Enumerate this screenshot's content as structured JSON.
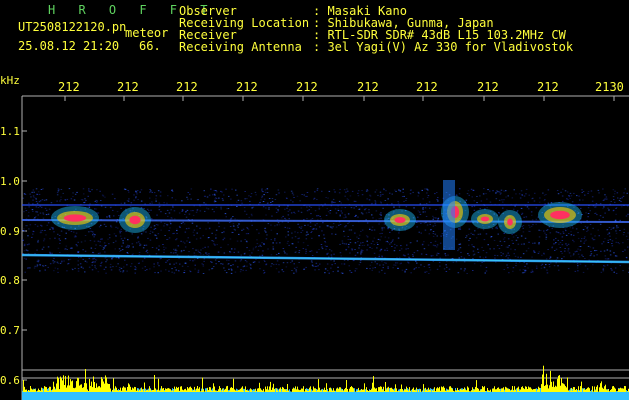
{
  "header": {
    "title": "H R O F F T",
    "file_name": "UT2508122120.pn",
    "mode": "meteor",
    "datetime": "25.08.12 21:20",
    "count": "66.",
    "fields": [
      {
        "label": "Observer",
        "value": ": Masaki Kano"
      },
      {
        "label": "Receiving Location",
        "value": ": Shibukawa, Gunma, Japan"
      },
      {
        "label": "Receiver",
        "value": ": RTL-SDR SDR# 43dB L15 103.2MHz CW"
      },
      {
        "label": "Receiving Antenna",
        "value": ": 3el Yagi(V) Az 330 for Vladivostok"
      }
    ]
  },
  "axis": {
    "unit": "kHz",
    "time_ticks": [
      "212",
      "212",
      "212",
      "212",
      "212",
      "212",
      "212",
      "212",
      "212",
      "2130"
    ],
    "freq_ticks": [
      "1.1",
      "1.0",
      "0.9",
      "0.8",
      "0.7",
      "0.6"
    ]
  },
  "colors": {
    "text": "#ffff3c",
    "title": "#5fd35f",
    "echo_core": "#ff3060",
    "band": "#2850ff",
    "level": "#ffff00",
    "noise": "#30c0ff"
  }
}
